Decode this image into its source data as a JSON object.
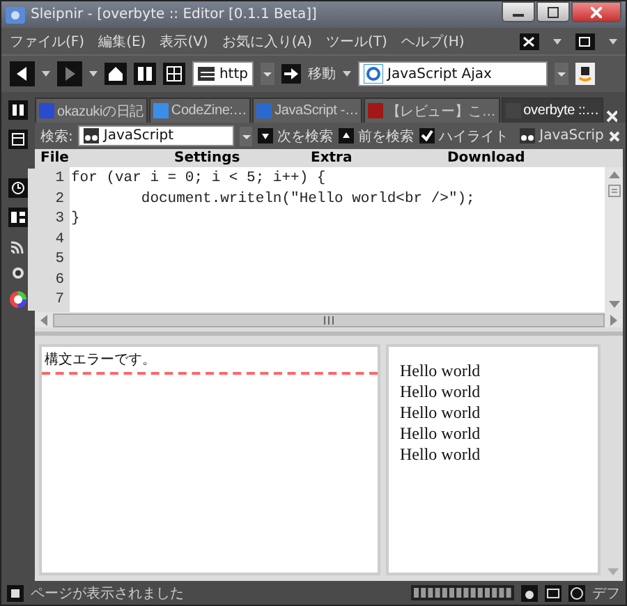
{
  "window": {
    "title": "Sleipnir - [overbyte :: Editor [0.1.1 Beta]]"
  },
  "menu": [
    "ファイル(F)",
    "編集(E)",
    "表示(V)",
    "お気に入り(A)",
    "ツール(T)",
    "ヘルプ(H)"
  ],
  "toolbar": {
    "address": "http",
    "go": "移動",
    "search": "JavaScript Ajax"
  },
  "tabs": [
    {
      "label": "okazukiの日記",
      "selected": false,
      "color": "#2a4bd0"
    },
    {
      "label": "CodeZine:…",
      "selected": false,
      "color": "#3a8ee8"
    },
    {
      "label": "JavaScript -…",
      "selected": false,
      "color": "#2a6ad0"
    },
    {
      "label": "【レビュー】こ…",
      "selected": false,
      "color": "#a01818"
    },
    {
      "label": "overbyte ::…",
      "selected": true,
      "color": "#444444"
    }
  ],
  "findbar": {
    "label": "検索:",
    "value": "JavaScript",
    "next": "次を検索",
    "prev": "前を検索",
    "highlight": {
      "label": "ハイライト",
      "checked": true
    },
    "keyword": "JavaScrip"
  },
  "editor_menu": [
    "File",
    "Settings",
    "Extra",
    "Download"
  ],
  "code": [
    {
      "n": "1",
      "text": "for (var i = 0; i < 5; i++) {"
    },
    {
      "n": "2",
      "text": "        document.writeln(\"Hello world<br />\");"
    },
    {
      "n": "3",
      "text": "}"
    },
    {
      "n": "4"
    },
    {
      "n": "5"
    },
    {
      "n": "6"
    },
    {
      "n": "7"
    }
  ],
  "error_pane": {
    "message": "構文エラーです。"
  },
  "output": [
    "Hello world",
    "Hello world",
    "Hello world",
    "Hello world",
    "Hello world"
  ],
  "status_bar": {
    "text": "ページが表示されました",
    "right": "デフ"
  }
}
